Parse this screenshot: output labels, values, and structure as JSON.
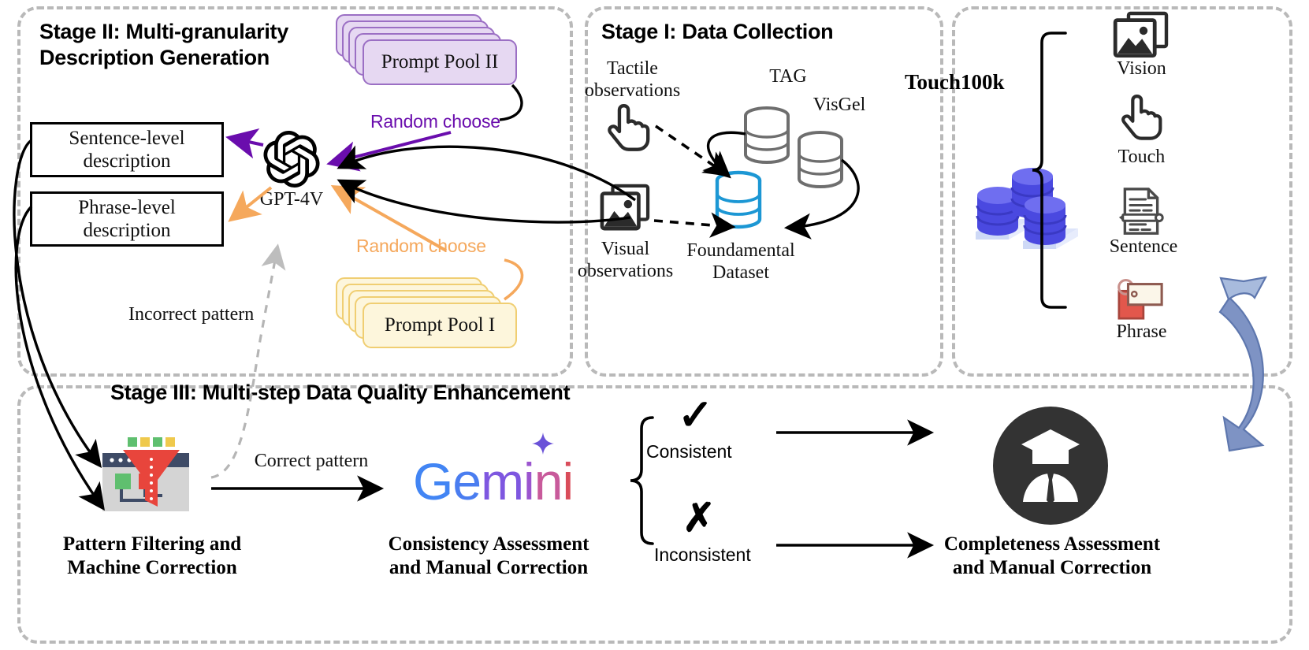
{
  "figure": {
    "type": "pipeline-diagram",
    "title_text_visible": false
  },
  "panels": {
    "stage2": {
      "title_line1": "Stage II: Multi-granularity",
      "title_line2": "Description Generation"
    },
    "stage1": {
      "title": "Stage I: Data Collection"
    },
    "dataset": {
      "title": "Touch100k"
    },
    "stage3": {
      "title": "Stage III: Multi-step Data Quality Enhancement"
    }
  },
  "stage2": {
    "prompt_pool_2": "Prompt Pool II",
    "prompt_pool_1": "Prompt Pool I",
    "random_choose_purple": "Random choose",
    "random_choose_orange": "Random choose",
    "sentence_box_line1": "Sentence-level",
    "sentence_box_line2": "description",
    "phrase_box_line1": "Phrase-level",
    "phrase_box_line2": "description",
    "model_label": "GPT-4V",
    "incorrect_pattern": "Incorrect pattern",
    "colors": {
      "purple": "#6A0DAD",
      "orange": "#F5A85C",
      "pool2_fill": "#E6D8F2",
      "pool2_stroke": "#9B6FC4",
      "pool1_fill": "#FDF6DC",
      "pool1_stroke": "#F2D27A"
    }
  },
  "stage1": {
    "tactile_line1": "Tactile",
    "tactile_line2": "observations",
    "visual_line1": "Visual",
    "visual_line2": "observations",
    "tag_label": "TAG",
    "visgel_label": "VisGel",
    "foundational_line1": "Foundamental",
    "foundational_line2": "Dataset",
    "colors": {
      "db_grey": "#6E6E6E",
      "db_blue": "#1C97D4"
    }
  },
  "dataset_panel": {
    "name": "Touch100k",
    "modalities": [
      {
        "label": "Vision",
        "icon": "image-stack-icon"
      },
      {
        "label": "Touch",
        "icon": "pointing-hand-icon"
      },
      {
        "label": "Sentence",
        "icon": "document-pencil-icon"
      },
      {
        "label": "Phrase",
        "icon": "tag-label-icon"
      }
    ],
    "colors": {
      "cyl_blue": "#4A49E0",
      "cyl_blue_light": "#6F6EF0",
      "base_blue": "#DDE4FA",
      "loop_arrow": "#7E93C4"
    }
  },
  "stage3": {
    "step1_line1": "Pattern Filtering and",
    "step1_line2": "Machine Correction",
    "step2_line1": "Consistency Assessment",
    "step2_line2": "and Manual Correction",
    "step3_line1": "Completeness Assessment",
    "step3_line2": "and Manual Correction",
    "correct_pattern": "Correct pattern",
    "consistent": "Consistent",
    "inconsistent": "Inconsistent",
    "check_mark": "✓",
    "cross_mark": "✗",
    "gemini_logo": "Gemini",
    "gemini_letters": [
      "G",
      "e",
      "m",
      "i",
      "n",
      "i"
    ],
    "gemini_colors": [
      "#4285F4",
      "#4285F4",
      "#7E57E0",
      "#8E57D1",
      "#C85A9B",
      "#D94C5A"
    ],
    "colors": {
      "funnel_red": "#E8453C",
      "funnel_navy": "#3E4B66",
      "funnel_grey": "#D4D4D4",
      "green_chip": "#5FBF6F",
      "yellow_chip": "#EFC94C",
      "expert_dark": "#333333"
    }
  }
}
